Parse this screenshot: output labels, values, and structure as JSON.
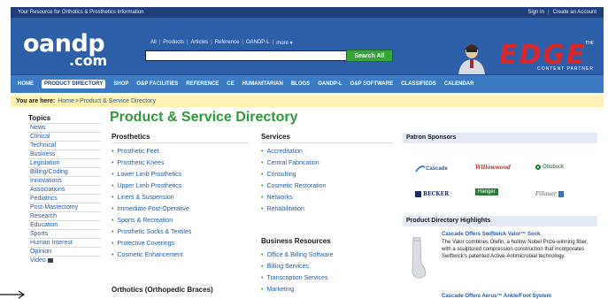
{
  "topbar": {
    "tagline": "Your Resource for Orthotics & Prosthetics Information",
    "sign_in": "Sign In",
    "separator": "|",
    "create_account": "Create an Account"
  },
  "header": {
    "logo_main": "oandp",
    "logo_suffix": ".com",
    "search_scope": [
      "All",
      "Products",
      "Articles",
      "Reference",
      "OANDP-L",
      "more ▾"
    ],
    "search_value": "",
    "search_button": "Search All",
    "edge": {
      "the": "THE",
      "word": "EDGE",
      "subtitle": "CONTENT PARTNER"
    }
  },
  "nav": {
    "items": [
      "HOME",
      "PRODUCT DIRECTORY",
      "SHOP",
      "O&P FACILITIES",
      "REFERENCE",
      "CE",
      "HUMANITARIAN",
      "BLOGS",
      "OANDP-L",
      "O&P SOFTWARE",
      "CLASSIFIEDS",
      "CALENDAR"
    ],
    "active_index": 1
  },
  "breadcrumb": {
    "label": "You are here:",
    "home": "Home",
    "separator": ">",
    "current": "Product & Service Directory"
  },
  "sidebar": {
    "heading": "Topics",
    "items": [
      "News",
      "Clinical",
      "Technical",
      "Business",
      "Legislation",
      "Billing/Coding",
      "Innovations",
      "Associations",
      "Pediatrics",
      "Post-Mastectomy",
      "Research",
      "Education",
      "Sports",
      "Human Interest",
      "Opinion",
      "Video"
    ]
  },
  "main": {
    "title": "Product & Service Directory",
    "prosthetics": {
      "heading": "Prosthetics",
      "items": [
        "Prosthetic Feet",
        "Prosthetic Knees",
        "Lower Limb Prosthetics",
        "Upper Limb Prosthetics",
        "Liners & Suspension",
        "Immediate Post-Operative",
        "Sports & Recreation",
        "Prosthetic Socks & Textiles",
        "Protective Coverings",
        "Cosmetic Enhancement"
      ]
    },
    "orthotics": {
      "heading": "Orthotics (Orthopedic Braces)"
    },
    "services": {
      "heading": "Services",
      "items": [
        "Accreditation",
        "Central Fabrication",
        "Consulting",
        "Cosmetic Restoration",
        "Networks",
        "Rehabilitation"
      ]
    },
    "business": {
      "heading": "Business Resources",
      "items": [
        "Office & Billing Software",
        "Billing Services",
        "Transcription Services",
        "Marketing"
      ]
    }
  },
  "panel": {
    "sponsors_heading": "Patron Sponsors",
    "sponsors": [
      "Cascade",
      "Willowwood",
      "Ottobock",
      "BECKER",
      "Hanger",
      "Fillauer"
    ],
    "highlights_heading": "Product Directory Highlights",
    "highlight_title": "Cascade Offers Swiftwick Valor™ Sock",
    "highlight_body": "The Valor combines Olefin, a hollow Nobel Prize-winning fiber, with a sculptured compression construction that incorporates Swiftwick's patented Active-Antimicrobial technology.",
    "highlight_title_2": "Cascade Offers Aerus™ Ankle/Foot System"
  },
  "colors": {
    "header_blue": "#2d5fa8",
    "nav_blue": "#3c7ac4",
    "accent_green": "#2e9a3a",
    "link_blue": "#1f5db0",
    "edge_red": "#d9262a",
    "breadcrumb_yellow": "#fff2b3"
  }
}
